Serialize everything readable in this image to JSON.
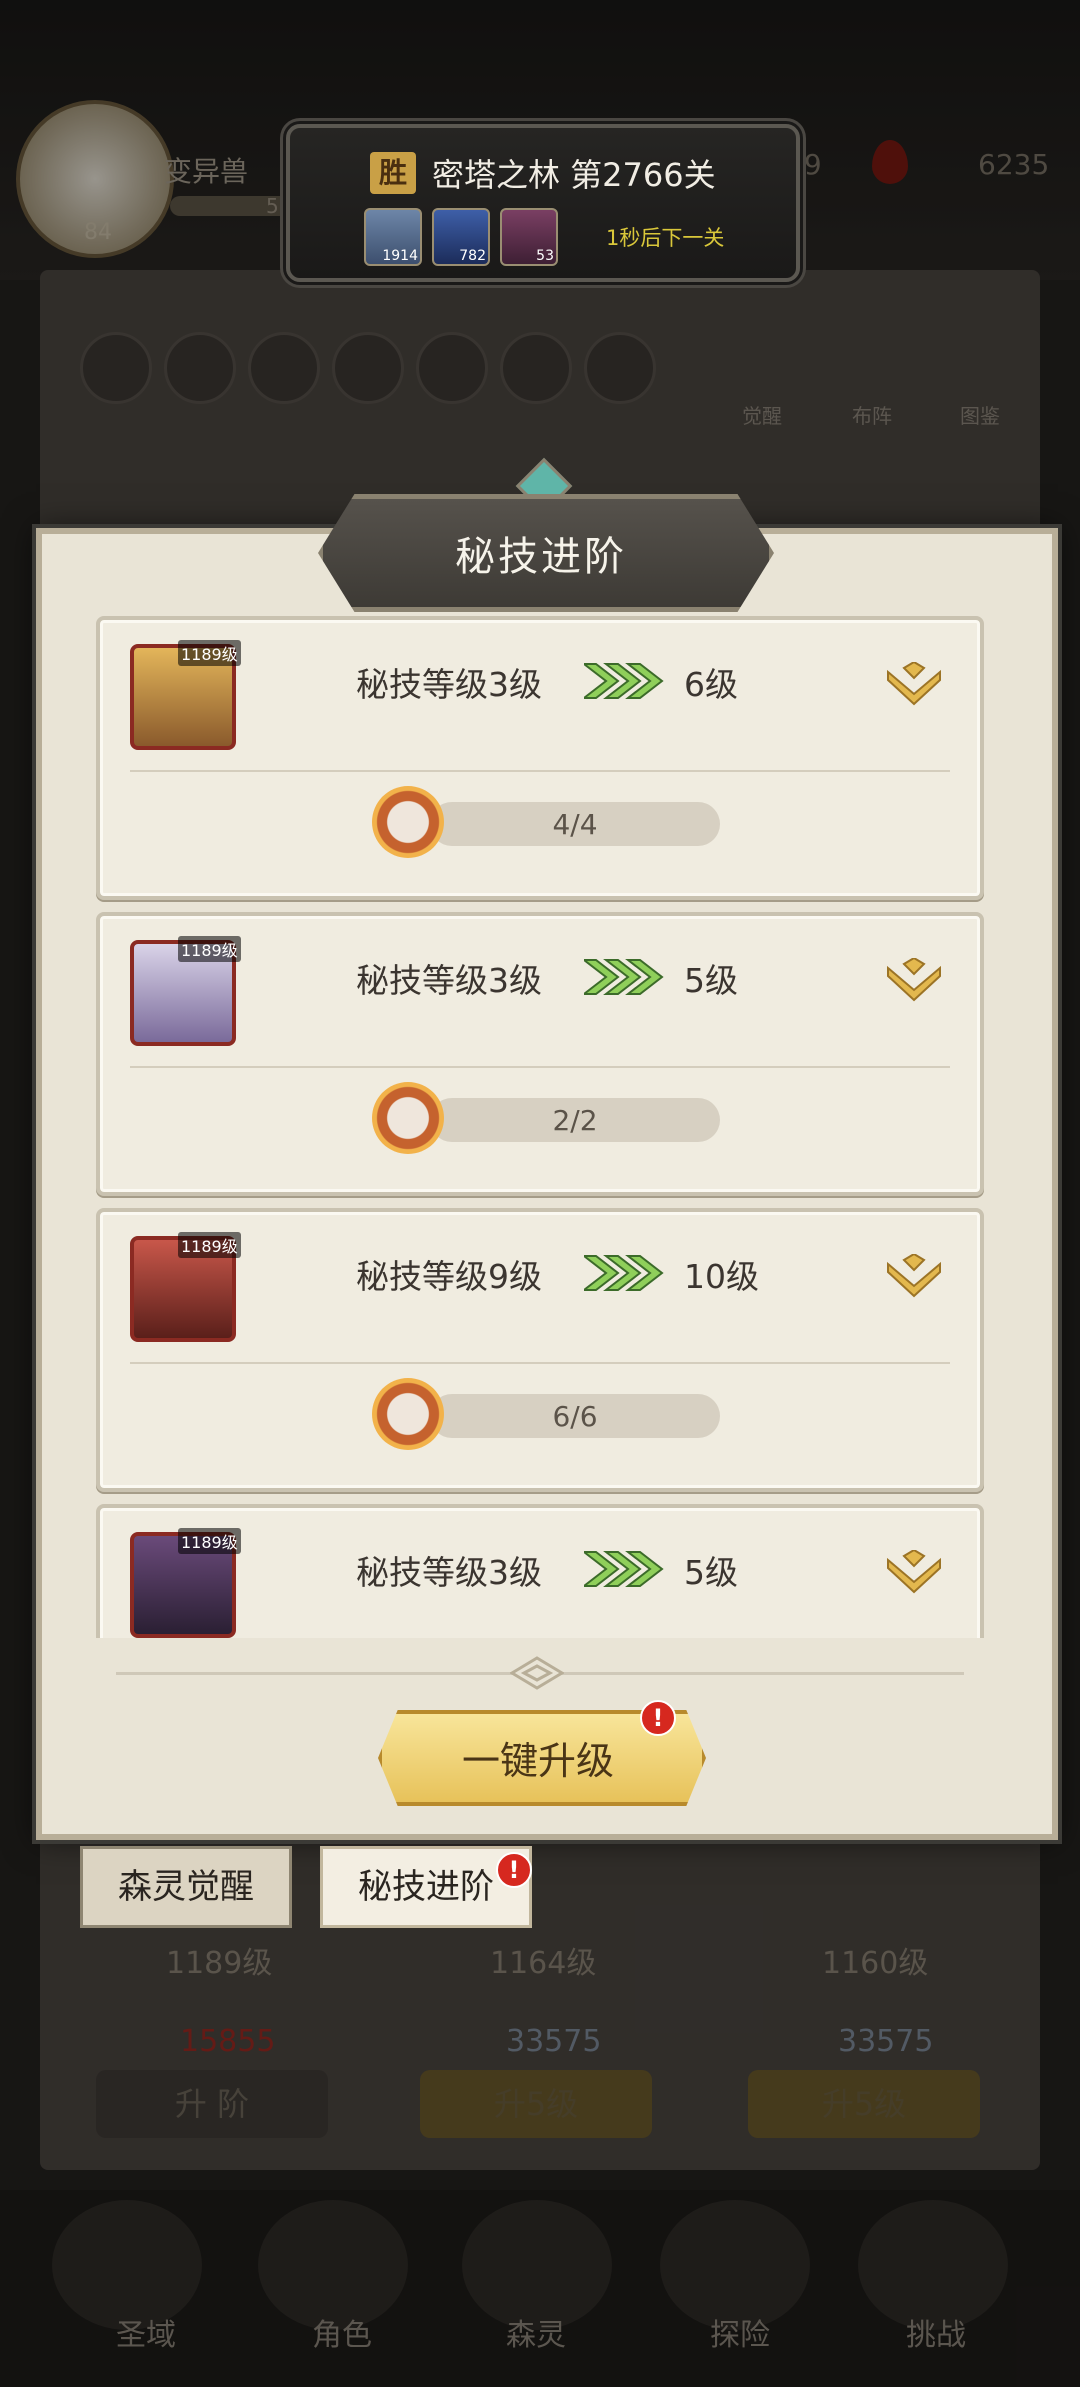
{
  "player": {
    "name": "变异兽",
    "level": "84",
    "exp": "582"
  },
  "top_resources": {
    "res1": "69",
    "res2": "6235"
  },
  "stage": {
    "badge": "胜",
    "title": "密塔之林 第2766关",
    "items": [
      {
        "count": "1914"
      },
      {
        "count": "782"
      },
      {
        "count": "53"
      }
    ],
    "next_text": "1秒后下一关"
  },
  "side_buttons": {
    "awaken": "觉醒",
    "formation": "布阵",
    "atlas": "图鉴"
  },
  "dialog": {
    "title": "秘技进阶",
    "cards": [
      {
        "portrait_level": "1189级",
        "label": "秘技等级3级",
        "target": "6级",
        "progress": "4/4"
      },
      {
        "portrait_level": "1189级",
        "label": "秘技等级3级",
        "target": "5级",
        "progress": "2/2"
      },
      {
        "portrait_level": "1189级",
        "label": "秘技等级9级",
        "target": "10级",
        "progress": "6/6"
      },
      {
        "portrait_level": "1189级",
        "label": "秘技等级3级",
        "target": "5级",
        "progress": ""
      }
    ],
    "upgrade_button": "一键升级",
    "badge": "!"
  },
  "tabs": {
    "awaken": "森灵觉醒",
    "advance": "秘技进阶"
  },
  "background": {
    "levels": [
      "1189级",
      "1164级",
      "1160级"
    ],
    "costs": [
      "15855",
      "33575",
      "33575"
    ],
    "buttons": [
      "升 阶",
      "升5级",
      "升5级"
    ]
  },
  "nav": {
    "items": [
      "圣域",
      "角色",
      "森灵",
      "探险",
      "挑战"
    ]
  },
  "colors": {
    "accent_gold": "#e7c25a",
    "badge_red": "#d6281f",
    "arrow_green": "#7cc24a"
  }
}
